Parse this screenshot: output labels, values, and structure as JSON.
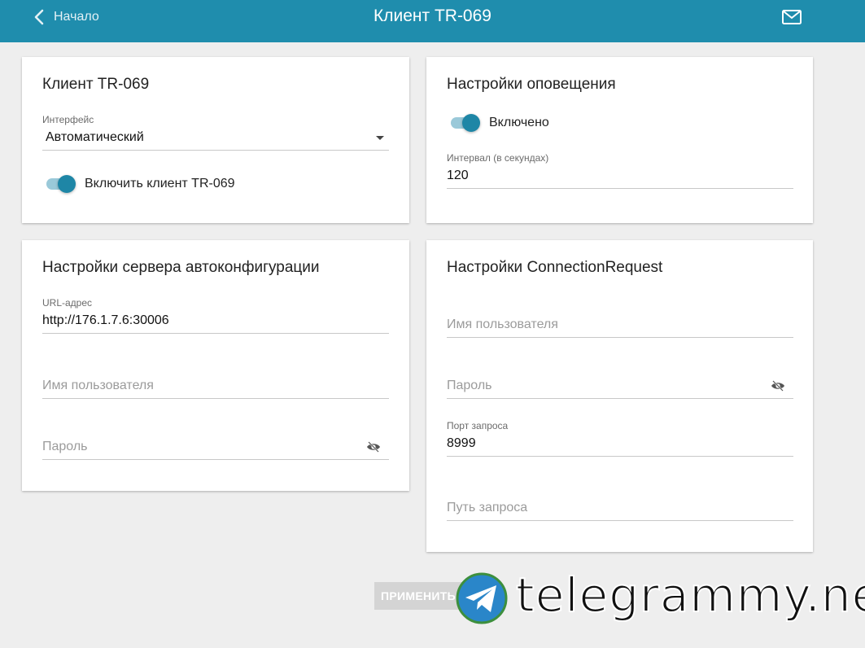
{
  "header": {
    "back_label": "Начало",
    "title": "Клиент TR-069"
  },
  "card_client": {
    "title": "Клиент TR-069",
    "interface_label": "Интерфейс",
    "interface_value": "Автоматический",
    "enable_label": "Включить клиент TR-069",
    "enable_on": true
  },
  "card_notify": {
    "title": "Настройки оповещения",
    "enabled_label": "Включено",
    "enabled_on": true,
    "interval_label": "Интервал (в секундах)",
    "interval_value": "120"
  },
  "card_acs": {
    "title": "Настройки сервера автоконфигурации",
    "url_label": "URL-адрес",
    "url_value": "http://176.1.7.6:30006",
    "username_placeholder": "Имя пользователя",
    "password_placeholder": "Пароль"
  },
  "card_cr": {
    "title": "Настройки ConnectionRequest",
    "username_placeholder": "Имя пользователя",
    "password_placeholder": "Пароль",
    "port_label": "Порт запроса",
    "port_value": "8999",
    "path_placeholder": "Путь запроса"
  },
  "apply_label": "ПРИМЕНИТЬ",
  "watermark": "telegrammy.net",
  "colors": {
    "header": "#1f8dad",
    "accent": "#1e86a6",
    "toggle_track": "#9ac9d9",
    "background": "#eeeeee"
  }
}
